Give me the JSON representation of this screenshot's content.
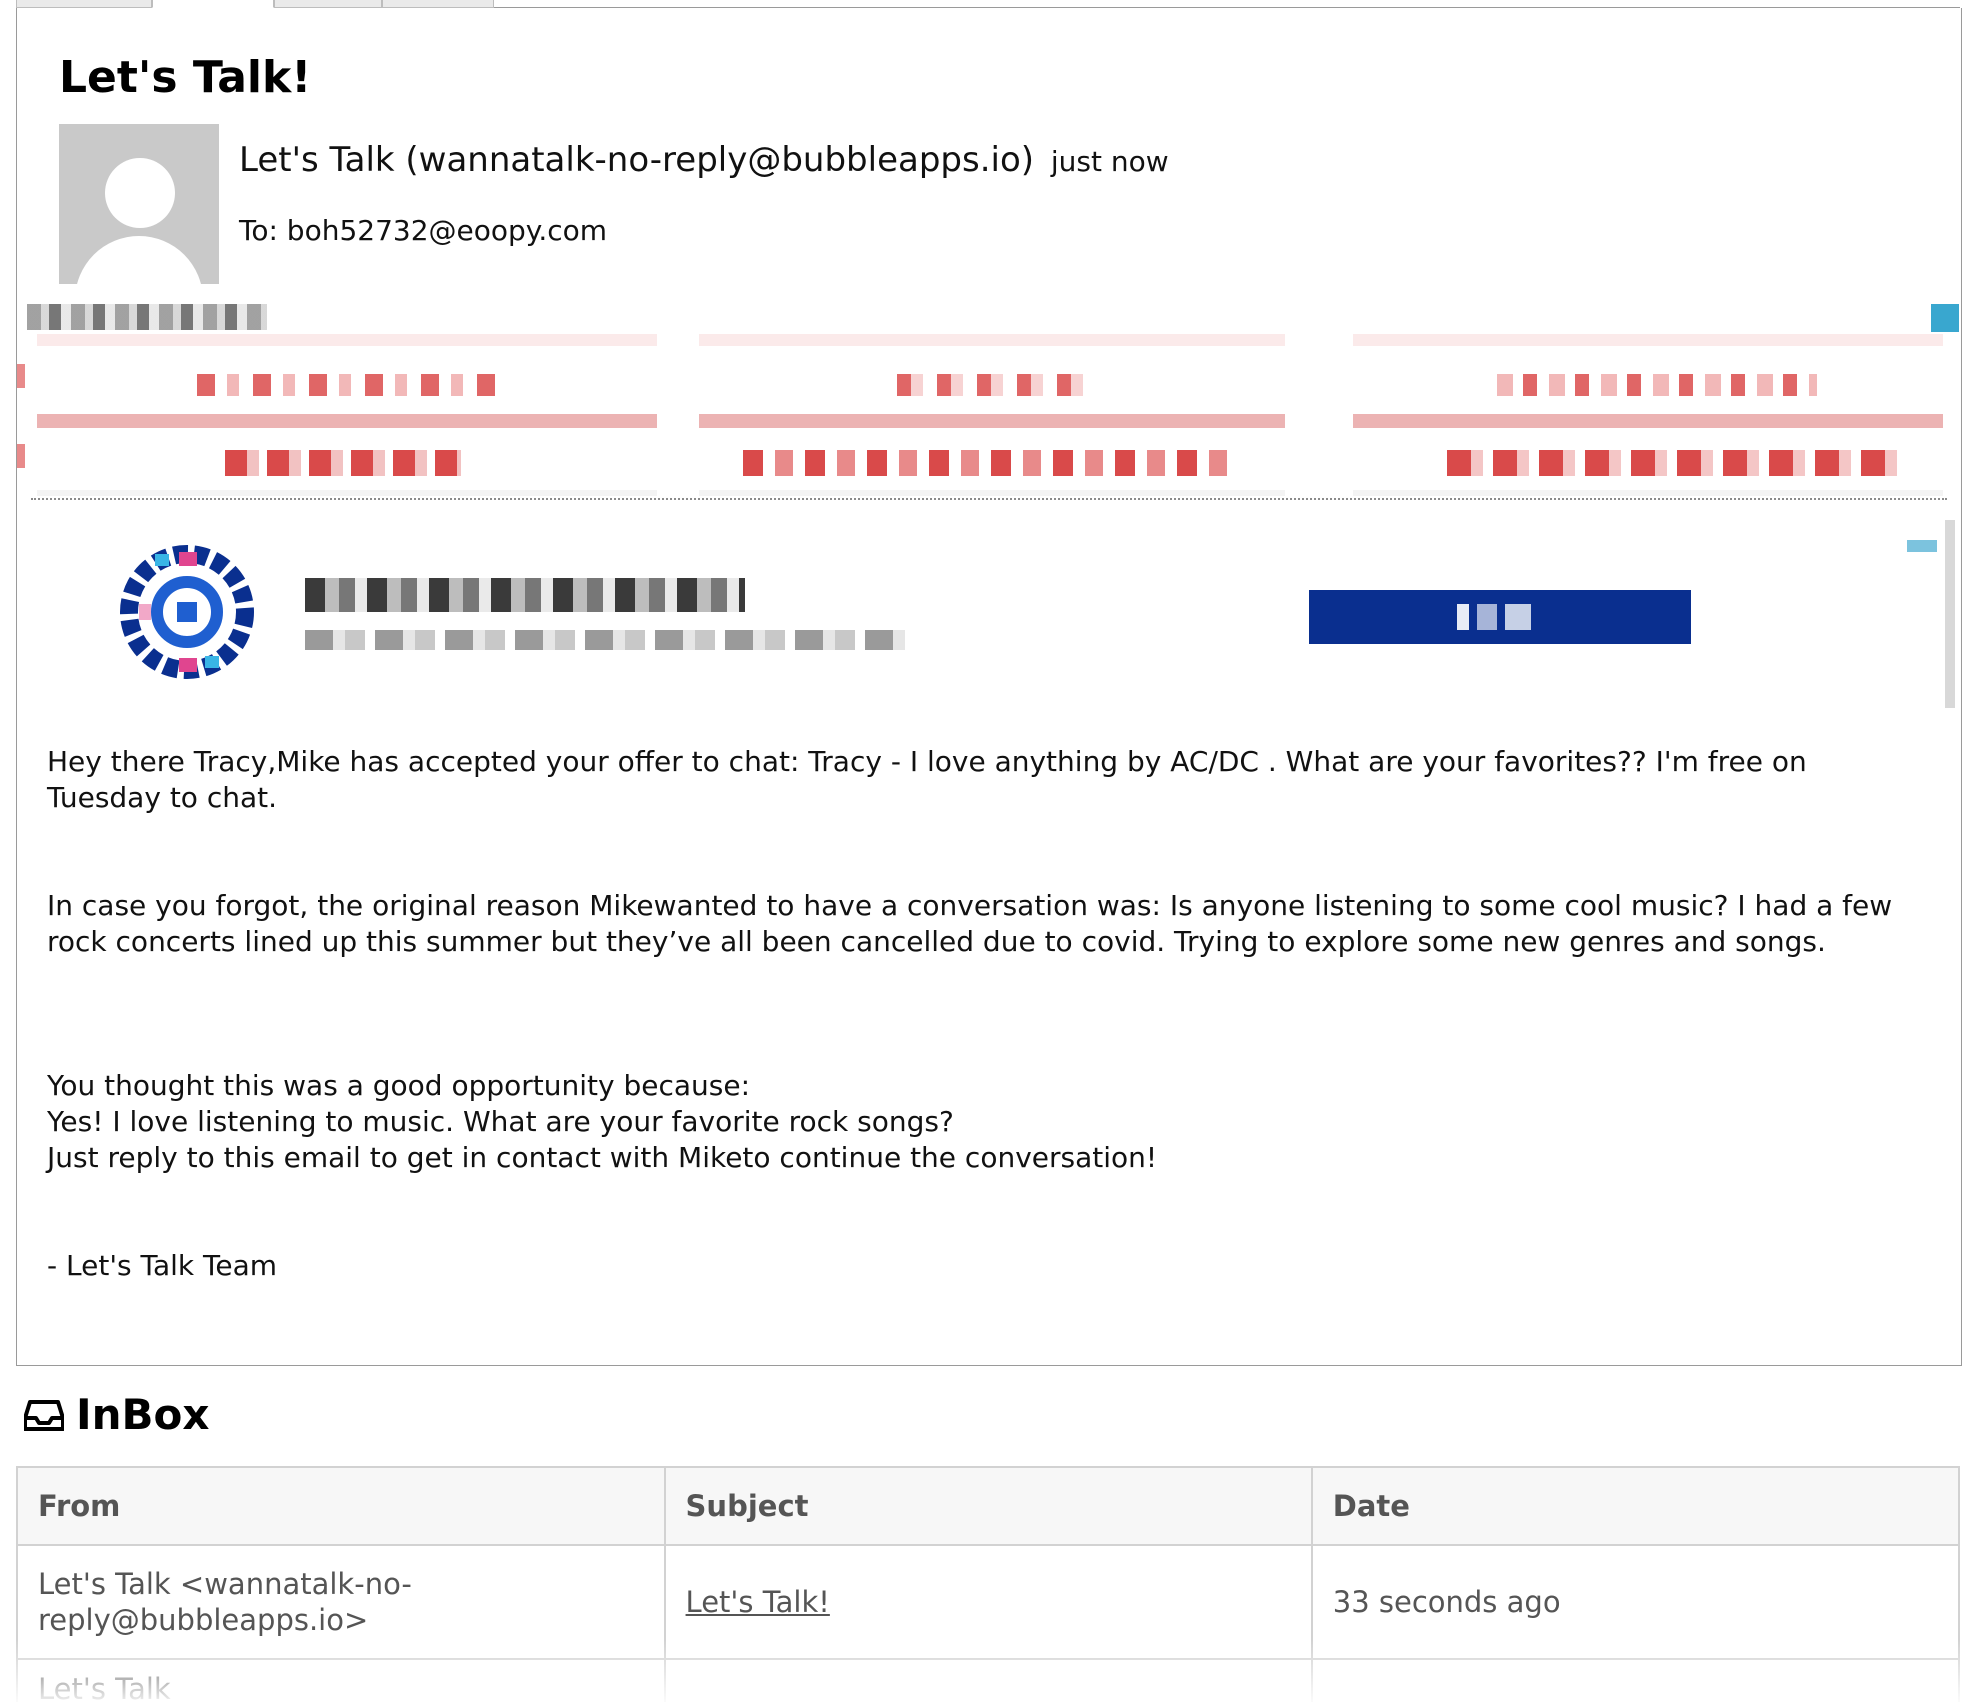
{
  "email": {
    "subject": "Let's Talk!",
    "sender": "Let's Talk (wannatalk-no-reply@bubbleapps.io)",
    "time": "just now",
    "to": "To: boh52732@eoopy.com",
    "body": {
      "p1": "Hey there Tracy,Mike has accepted your offer to chat: Tracy - I love anything by AC/DC . What are your favorites?? I'm free on Tuesday to chat.",
      "p2": "In case you forgot, the original reason Mikewanted to have a conversation was: Is anyone listening to some cool music? I had a few rock concerts lined up this summer but they’ve all been cancelled due to covid. Trying to explore some new genres and songs.",
      "p3_line1": "You thought this was a good opportunity because:",
      "p3_line2": "Yes! I love listening to music. What are your favorite rock songs?",
      "p3_line3": "Just reply to this email to get in contact with Miketo continue the conversation!",
      "signature": "- Let's Talk Team"
    }
  },
  "inbox": {
    "title": "InBox",
    "columns": [
      "From",
      "Subject",
      "Date"
    ],
    "rows": [
      {
        "from_line1": "Let's Talk <wannatalk-no-",
        "from_line2": "reply@bubbleapps.io>",
        "subject": "Let's Talk!",
        "date": "33 seconds ago"
      }
    ],
    "partial_row_from": "Let's Talk"
  },
  "colors": {
    "ad_red": "#d94a4a",
    "banner_blue": "#0a2f8f",
    "avatar_gray": "#c9c9c9"
  },
  "icons": {
    "inbox": "inbox-tray-icon",
    "avatar": "default-avatar-icon",
    "logo": "pixelated-brand-logo-icon"
  }
}
